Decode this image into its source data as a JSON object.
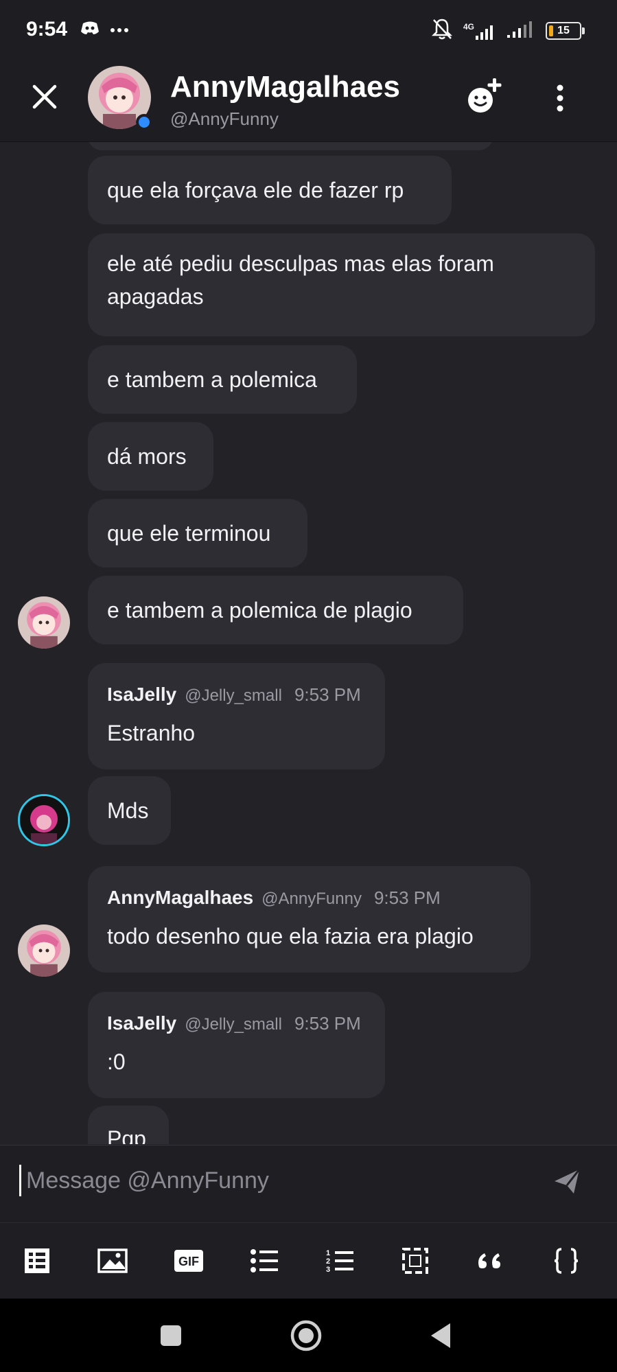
{
  "status_bar": {
    "time": "9:54",
    "network": "4G",
    "battery": "15",
    "battery_color": "#f1a91d"
  },
  "header": {
    "name": "AnnyMagalhaes",
    "handle": "@AnnyFunny",
    "online_color": "#2f8cff"
  },
  "messages": [
    {
      "text": "que ela forçava ele de fazer rp"
    },
    {
      "text": "ele até pediu desculpas mas elas foram apagadas"
    },
    {
      "text": "e tambem a polemica"
    },
    {
      "text": "dá mors"
    },
    {
      "text": "que ele terminou"
    },
    {
      "text": "e tambem a polemica de plagio"
    },
    {
      "author": "IsaJelly",
      "handle": "@Jelly_small",
      "time": "9:53 PM",
      "text": "Estranho"
    },
    {
      "text": "Mds"
    },
    {
      "author": "AnnyMagalhaes",
      "handle": "@AnnyFunny",
      "time": "9:53 PM",
      "text": "todo desenho que ela fazia era plagio"
    },
    {
      "author": "IsaJelly",
      "handle": "@Jelly_small",
      "time": "9:53 PM",
      "text": ":0"
    },
    {
      "text": "Pqp"
    }
  ],
  "composer": {
    "placeholder": "Message @AnnyFunny"
  },
  "format_toolbar": {
    "gif_label": "GIF",
    "icons": [
      "spoiler-icon",
      "image-icon",
      "gif-icon",
      "bullet-list-icon",
      "numbered-list-icon",
      "select-icon",
      "quote-icon",
      "code-block-icon"
    ]
  },
  "colors": {
    "background": "#232227",
    "bubble": "#2e2d33",
    "header": "#1e1d21"
  }
}
